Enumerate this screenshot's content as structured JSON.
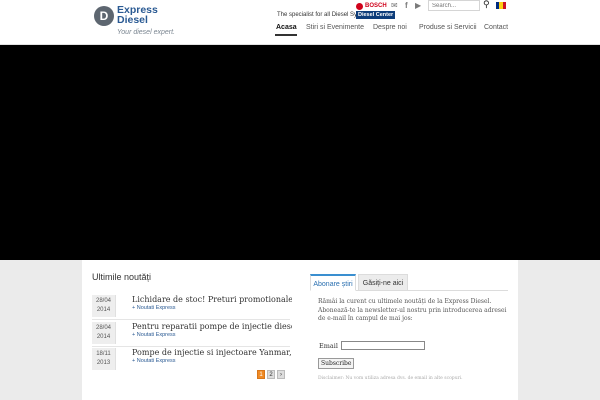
{
  "brand": {
    "mark": "D",
    "name_line1": "Express",
    "name_line2": "Diesel",
    "tagline": "Your diesel expert.",
    "color": "#2a5a93"
  },
  "topbar": {
    "specialist": "The specialist for all Diesel Systems",
    "bosch": "BOSCH",
    "diesel_center": "Diesel Center",
    "social_icons": [
      "mail-icon",
      "facebook-icon",
      "youtube-icon"
    ],
    "search_placeholder": "Search...",
    "language_flag": "romania-flag-icon",
    "flag_colors": [
      "#002b7f",
      "#fcd116",
      "#ce1126"
    ]
  },
  "nav": {
    "items": [
      {
        "label": "Acasa",
        "active": true
      },
      {
        "label": "Stiri si Evenimente"
      },
      {
        "label": "Despre noi"
      },
      {
        "label": "Produse si Servicii"
      },
      {
        "label": "Contact"
      }
    ]
  },
  "news": {
    "title": "Ultimile noutăți",
    "items": [
      {
        "day": "28/04",
        "year": "2014",
        "headline": "Lichidare de stoc! Preturi promotionale pentru",
        "category": "+ Noutati Express"
      },
      {
        "day": "28/04",
        "year": "2014",
        "headline": "Pentru reparatii pompe de injectie diesel Bosch",
        "category": "+ Noutati Express"
      },
      {
        "day": "18/11",
        "year": "2013",
        "headline": "Pompe de injectie si injectoare Yanmar, Cummins",
        "category": "+ Noutati Express"
      }
    ],
    "pages": [
      "1",
      "2",
      "›"
    ],
    "current_page": "1"
  },
  "sidebar": {
    "tabs": [
      "Abonare știri",
      "Găsiți-ne aici"
    ],
    "active_tab": "Abonare știri",
    "text": "Rămâi la curent cu ultimele noutăți de la Express Diesel. Abonează-te la newsletter-ul nostru prin introducerea adresei de e-mail în campul de mai jos:",
    "email_label": "Email",
    "email_value": "",
    "subscribe_label": "Subscribe",
    "disclaimer": "Disclaimer: Nu vom utiliza adresa dvs. de email in alte scopuri."
  }
}
